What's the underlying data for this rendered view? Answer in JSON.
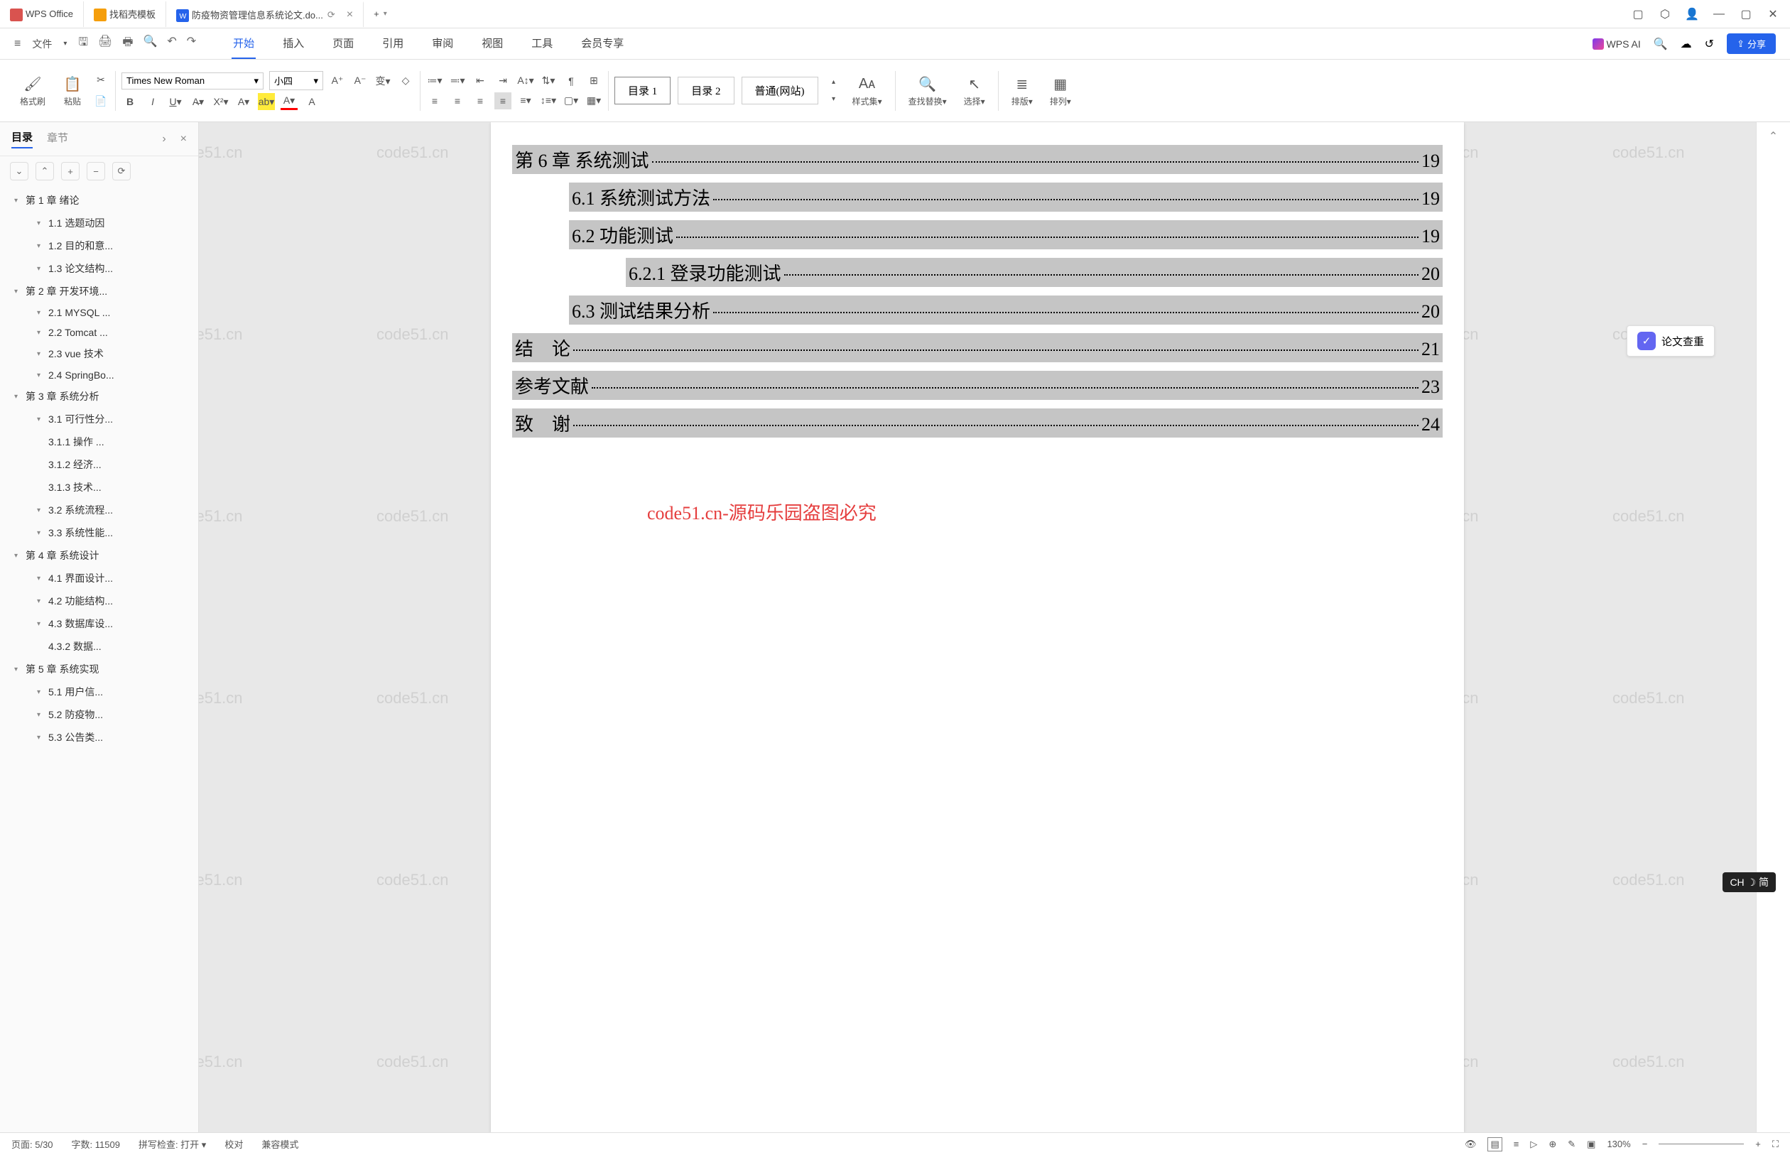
{
  "titlebar": {
    "app": "WPS Office",
    "tab1": "找稻壳模板",
    "tab2": "防疫物资管理信息系统论文.do...",
    "addTab": "+"
  },
  "menubar": {
    "fileMenu": "文件",
    "tabs": [
      "开始",
      "插入",
      "页面",
      "引用",
      "审阅",
      "视图",
      "工具",
      "会员专享"
    ],
    "wpsAI": "WPS AI",
    "share": "分享"
  },
  "ribbon": {
    "formatPainter": "格式刷",
    "paste": "粘贴",
    "font": "Times New Roman",
    "fontSize": "小四",
    "styles": [
      "目录 1",
      "目录 2",
      "普通(网站)"
    ],
    "styleSet": "样式集",
    "findReplace": "查找替换",
    "select": "选择",
    "arrange1": "排版",
    "arrange2": "排列"
  },
  "sidebar": {
    "tabs": [
      "目录",
      "章节"
    ],
    "items": [
      {
        "lvl": 1,
        "t": "第 1 章 绪论"
      },
      {
        "lvl": 2,
        "t": "1.1 选题动因"
      },
      {
        "lvl": 2,
        "t": "1.2 目的和意..."
      },
      {
        "lvl": 2,
        "t": "1.3 论文结构..."
      },
      {
        "lvl": 1,
        "t": "第 2 章 开发环境..."
      },
      {
        "lvl": 2,
        "t": "2.1 MYSQL ..."
      },
      {
        "lvl": 2,
        "t": "2.2 Tomcat ..."
      },
      {
        "lvl": 2,
        "t": "2.3 vue 技术"
      },
      {
        "lvl": 2,
        "t": "2.4 SpringBo..."
      },
      {
        "lvl": 1,
        "t": "第 3 章 系统分析"
      },
      {
        "lvl": 2,
        "t": "3.1 可行性分..."
      },
      {
        "lvl": 3,
        "t": "3.1.1 操作 ..."
      },
      {
        "lvl": 3,
        "t": "3.1.2 经济..."
      },
      {
        "lvl": 3,
        "t": "3.1.3 技术..."
      },
      {
        "lvl": 2,
        "t": "3.2 系统流程..."
      },
      {
        "lvl": 2,
        "t": "3.3 系统性能..."
      },
      {
        "lvl": 1,
        "t": "第 4 章 系统设计"
      },
      {
        "lvl": 2,
        "t": "4.1 界面设计..."
      },
      {
        "lvl": 2,
        "t": "4.2 功能结构..."
      },
      {
        "lvl": 2,
        "t": "4.3 数据库设..."
      },
      {
        "lvl": 3,
        "t": "4.3.2 数据..."
      },
      {
        "lvl": 1,
        "t": "第 5 章 系统实现"
      },
      {
        "lvl": 2,
        "t": "5.1 用户信..."
      },
      {
        "lvl": 2,
        "t": "5.2 防疫物..."
      },
      {
        "lvl": 2,
        "t": "5.3 公告类..."
      }
    ]
  },
  "toc": [
    {
      "ind": 1,
      "title": "第 6 章  系统测试",
      "pg": "19"
    },
    {
      "ind": 2,
      "title": "6.1  系统测试方法",
      "pg": "19"
    },
    {
      "ind": 2,
      "title": "6.2  功能测试",
      "pg": "19"
    },
    {
      "ind": 3,
      "title": "6.2.1  登录功能测试",
      "pg": "20"
    },
    {
      "ind": 2,
      "title": "6.3  测试结果分析",
      "pg": "20"
    },
    {
      "ind": 1,
      "title": "结　论",
      "pg": "21"
    },
    {
      "ind": 1,
      "title": "参考文献",
      "pg": "23"
    },
    {
      "ind": 1,
      "title": "致　谢",
      "pg": "24"
    }
  ],
  "watermarkCenter": "code51.cn-源码乐园盗图必究",
  "wmText": "code51.cn",
  "paperCheck": "论文查重",
  "status": {
    "page": "页面: 5/30",
    "words": "字数: 11509",
    "spell": "拼写检查: 打开",
    "proof": "校对",
    "compat": "兼容模式",
    "zoom": "130%"
  },
  "ime": "CH ☽ 简"
}
